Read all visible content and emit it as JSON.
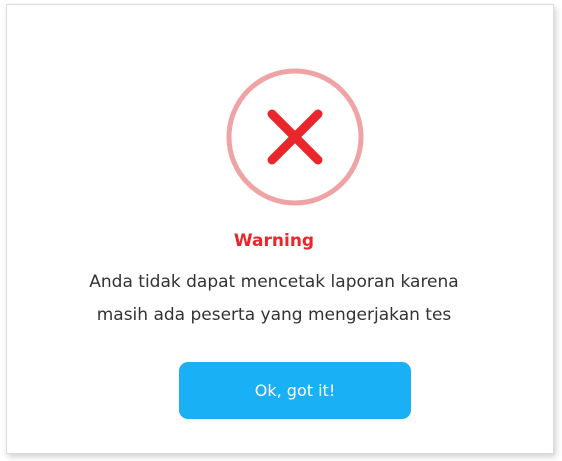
{
  "dialog": {
    "icon": "close-x-icon",
    "title": "Warning",
    "message_lines": [
      "Anda tidak dapat mencetak laporan karena",
      "masih ada peserta yang mengerjakan tes"
    ],
    "button_label": "Ok, got it!"
  },
  "colors": {
    "title": "#e8262c",
    "icon_ring": "#f0a3a5",
    "icon_cross": "#e8262c",
    "button": "#1ab0f5",
    "text": "#333333"
  }
}
